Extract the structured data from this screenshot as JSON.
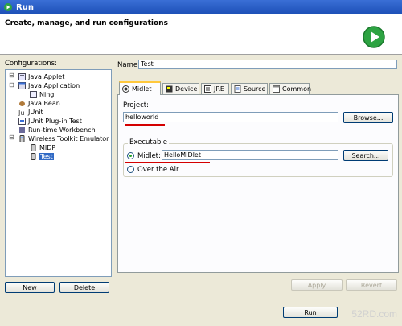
{
  "window": {
    "title": "Run"
  },
  "header": {
    "description": "Create, manage, and run configurations"
  },
  "configurations": {
    "label": "Configurations:",
    "tree": [
      {
        "label": "Java Applet"
      },
      {
        "label": "Java Application"
      },
      {
        "label": "Ning"
      },
      {
        "label": "Java Bean"
      },
      {
        "label": "JUnit"
      },
      {
        "label": "JUnit Plug-in Test"
      },
      {
        "label": "Run-time Workbench"
      },
      {
        "label": "Wireless Toolkit Emulator"
      },
      {
        "label": "MIDP"
      },
      {
        "label": "Test"
      }
    ],
    "new_label": "New",
    "delete_label": "Delete"
  },
  "name_field": {
    "label": "Name:",
    "value": "Test"
  },
  "tabs": [
    {
      "label": "Midlet"
    },
    {
      "label": "Device"
    },
    {
      "label": "JRE"
    },
    {
      "label": "Source"
    },
    {
      "label": "Common"
    }
  ],
  "midlet_tab": {
    "project_label": "Project:",
    "project_value": "helloworld",
    "browse_label": "Browse...",
    "executable_label": "Executable",
    "midlet_radio_label": "Midlet:",
    "midlet_value": "HelloMIDlet",
    "search_label": "Search...",
    "ota_label": "Over the Air"
  },
  "footer": {
    "apply_label": "Apply",
    "revert_label": "Revert",
    "run_label": "Run",
    "watermark": "52RD.com"
  },
  "colors": {
    "selection": "#316ac5",
    "run_icon": "#2da342",
    "annotation_red": "#d40000"
  }
}
